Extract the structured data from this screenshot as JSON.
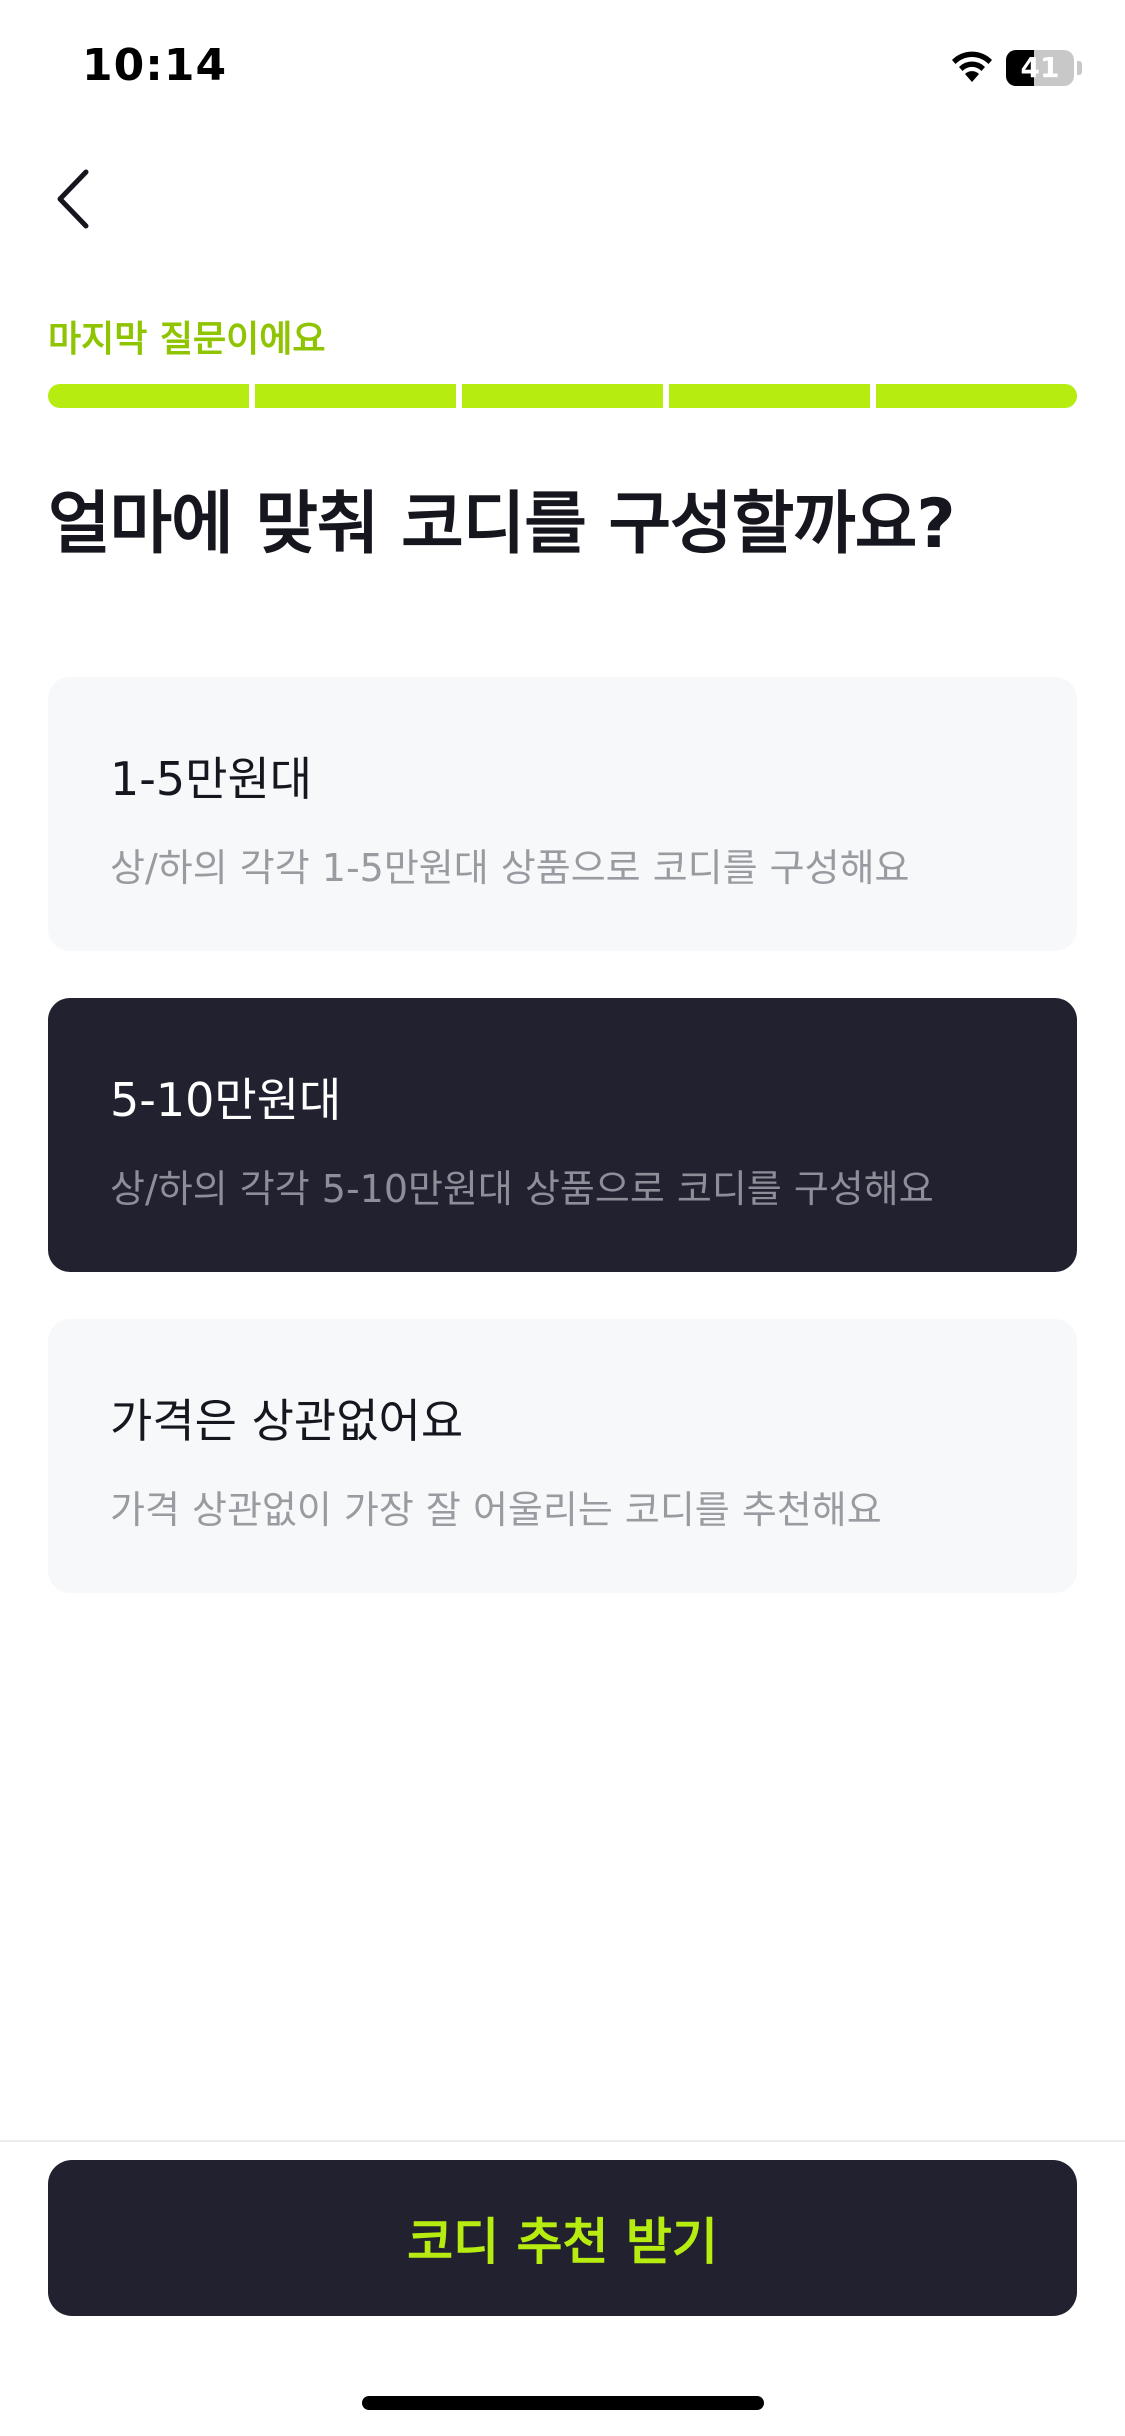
{
  "status_bar": {
    "time": "10:14",
    "battery_level": "41",
    "battery_fraction": 0.41,
    "icons": [
      "wifi-icon",
      "battery-icon"
    ]
  },
  "nav": {
    "back_icon": "chevron-left-icon"
  },
  "progress": {
    "caption": "마지막 질문이에요",
    "total_steps": 5,
    "completed_steps": 5,
    "accent_color": "#b7ec10",
    "caption_color": "#8fc400"
  },
  "question": {
    "title": "얼마에 맞춰 코디를 구성할까요?"
  },
  "options": [
    {
      "title": "1-5만원대",
      "description": "상/하의 각각 1-5만원대 상품으로 코디를 구성해요",
      "selected": false
    },
    {
      "title": "5-10만원대",
      "description": "상/하의 각각 5-10만원대 상품으로 코디를 구성해요",
      "selected": true
    },
    {
      "title": "가격은 상관없어요",
      "description": "가격 상관없이 가장 잘 어울리는 코디를 추천해요",
      "selected": false
    }
  ],
  "cta": {
    "label": "코디 추천 받기",
    "background": "#212130",
    "text_color": "#b7ec10"
  },
  "colors": {
    "card_default": "#f7f8fa",
    "card_selected": "#212130"
  }
}
